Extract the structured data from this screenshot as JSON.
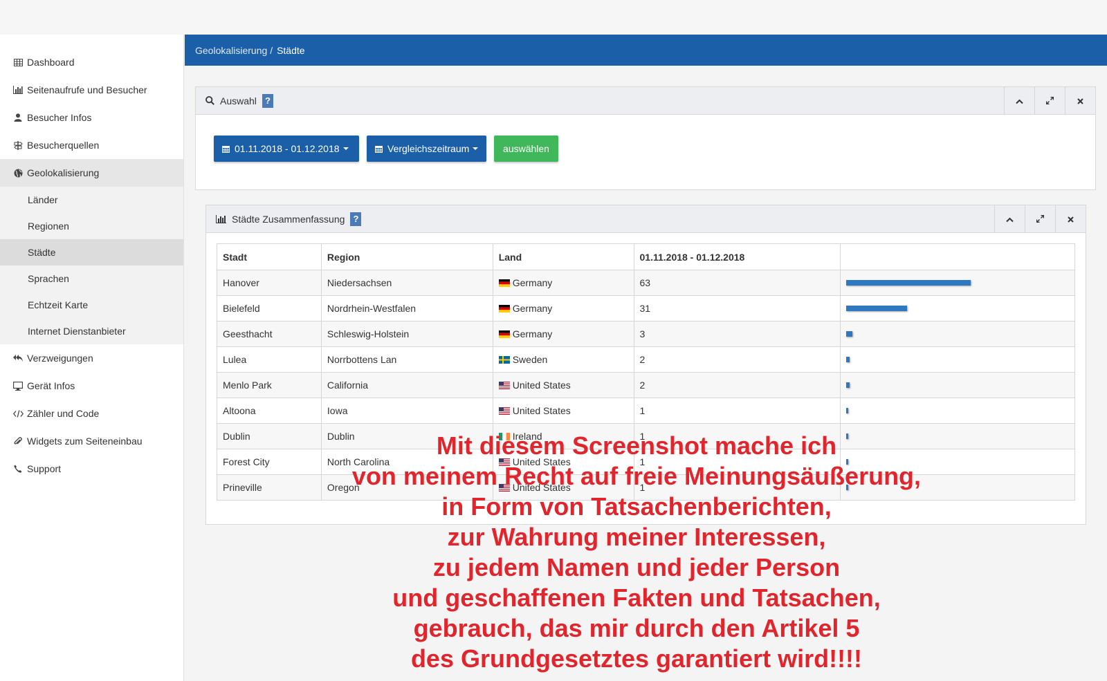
{
  "sidebar": {
    "items": [
      {
        "label": "Dashboard",
        "icon": "table-icon"
      },
      {
        "label": "Seitenaufrufe und Besucher",
        "icon": "bar-chart-icon"
      },
      {
        "label": "Besucher Infos",
        "icon": "user-icon"
      },
      {
        "label": "Besucherquellen",
        "icon": "signpost-icon"
      },
      {
        "label": "Geolokalisierung",
        "icon": "globe-icon"
      },
      {
        "label": "Verzweigungen",
        "icon": "reply-all-icon"
      },
      {
        "label": "Gerät Infos",
        "icon": "desktop-icon"
      },
      {
        "label": "Zähler und Code",
        "icon": "code-icon"
      },
      {
        "label": "Widgets zum Seiteneinbau",
        "icon": "paperclip-icon"
      },
      {
        "label": "Support",
        "icon": "phone-icon"
      }
    ],
    "submenu": [
      "Länder",
      "Regionen",
      "Städte",
      "Sprachen",
      "Echtzeit Karte",
      "Internet Dienstanbieter"
    ],
    "active_sub": "Städte"
  },
  "breadcrumb": {
    "parent": "Geolokalisierung",
    "separator": "/",
    "current": "Städte"
  },
  "selection_panel": {
    "title": "Auswahl",
    "help": "?",
    "date_range": "01.11.2018 - 01.12.2018",
    "compare": "Vergleichszeitraum",
    "apply": "auswählen"
  },
  "summary_panel": {
    "title": "Städte Zusammenfassung",
    "help": "?",
    "columns": [
      "Stadt",
      "Region",
      "Land",
      "01.11.2018 - 01.12.2018",
      ""
    ],
    "rows": [
      {
        "city": "Hanover",
        "region": "Niedersachsen",
        "country": "Germany",
        "flag": "de",
        "count": "63",
        "share": 1.0
      },
      {
        "city": "Bielefeld",
        "region": "Nordrhein-Westfalen",
        "country": "Germany",
        "flag": "de",
        "count": "31",
        "share": 0.49
      },
      {
        "city": "Geesthacht",
        "region": "Schleswig-Holstein",
        "country": "Germany",
        "flag": "de",
        "count": "3",
        "share": 0.05
      },
      {
        "city": "Lulea",
        "region": "Norrbottens Lan",
        "country": "Sweden",
        "flag": "se",
        "count": "2",
        "share": 0.03
      },
      {
        "city": "Menlo Park",
        "region": "California",
        "country": "United States",
        "flag": "us",
        "count": "2",
        "share": 0.03
      },
      {
        "city": "Altoona",
        "region": "Iowa",
        "country": "United States",
        "flag": "us",
        "count": "1",
        "share": 0.016
      },
      {
        "city": "Dublin",
        "region": "Dublin",
        "country": "Ireland",
        "flag": "ie",
        "count": "1",
        "share": 0.016
      },
      {
        "city": "Forest City",
        "region": "North Carolina",
        "country": "United States",
        "flag": "us",
        "count": "1",
        "share": 0.016
      },
      {
        "city": "Prineville",
        "region": "Oregon",
        "country": "United States",
        "flag": "us",
        "count": "1",
        "share": 0.016
      }
    ]
  },
  "overlay_text": [
    "Mit diesem Screenshot mache ich",
    "von meinem Recht auf freie Meinungsäußerung,",
    "in Form von Tatsachenberichten,",
    "zur Wahrung meiner Interessen,",
    "zu jedem Namen und jeder Person",
    "und geschaffenen Fakten und Tatsachen,",
    "gebrauch, das mir durch den Artikel 5",
    "des Grundgesetztes garantiert wird!!!!"
  ],
  "colors": {
    "primary": "#1b5fa8",
    "success": "#3fb75a",
    "bar": "#2e78c2",
    "overlay": "#e0262c"
  }
}
